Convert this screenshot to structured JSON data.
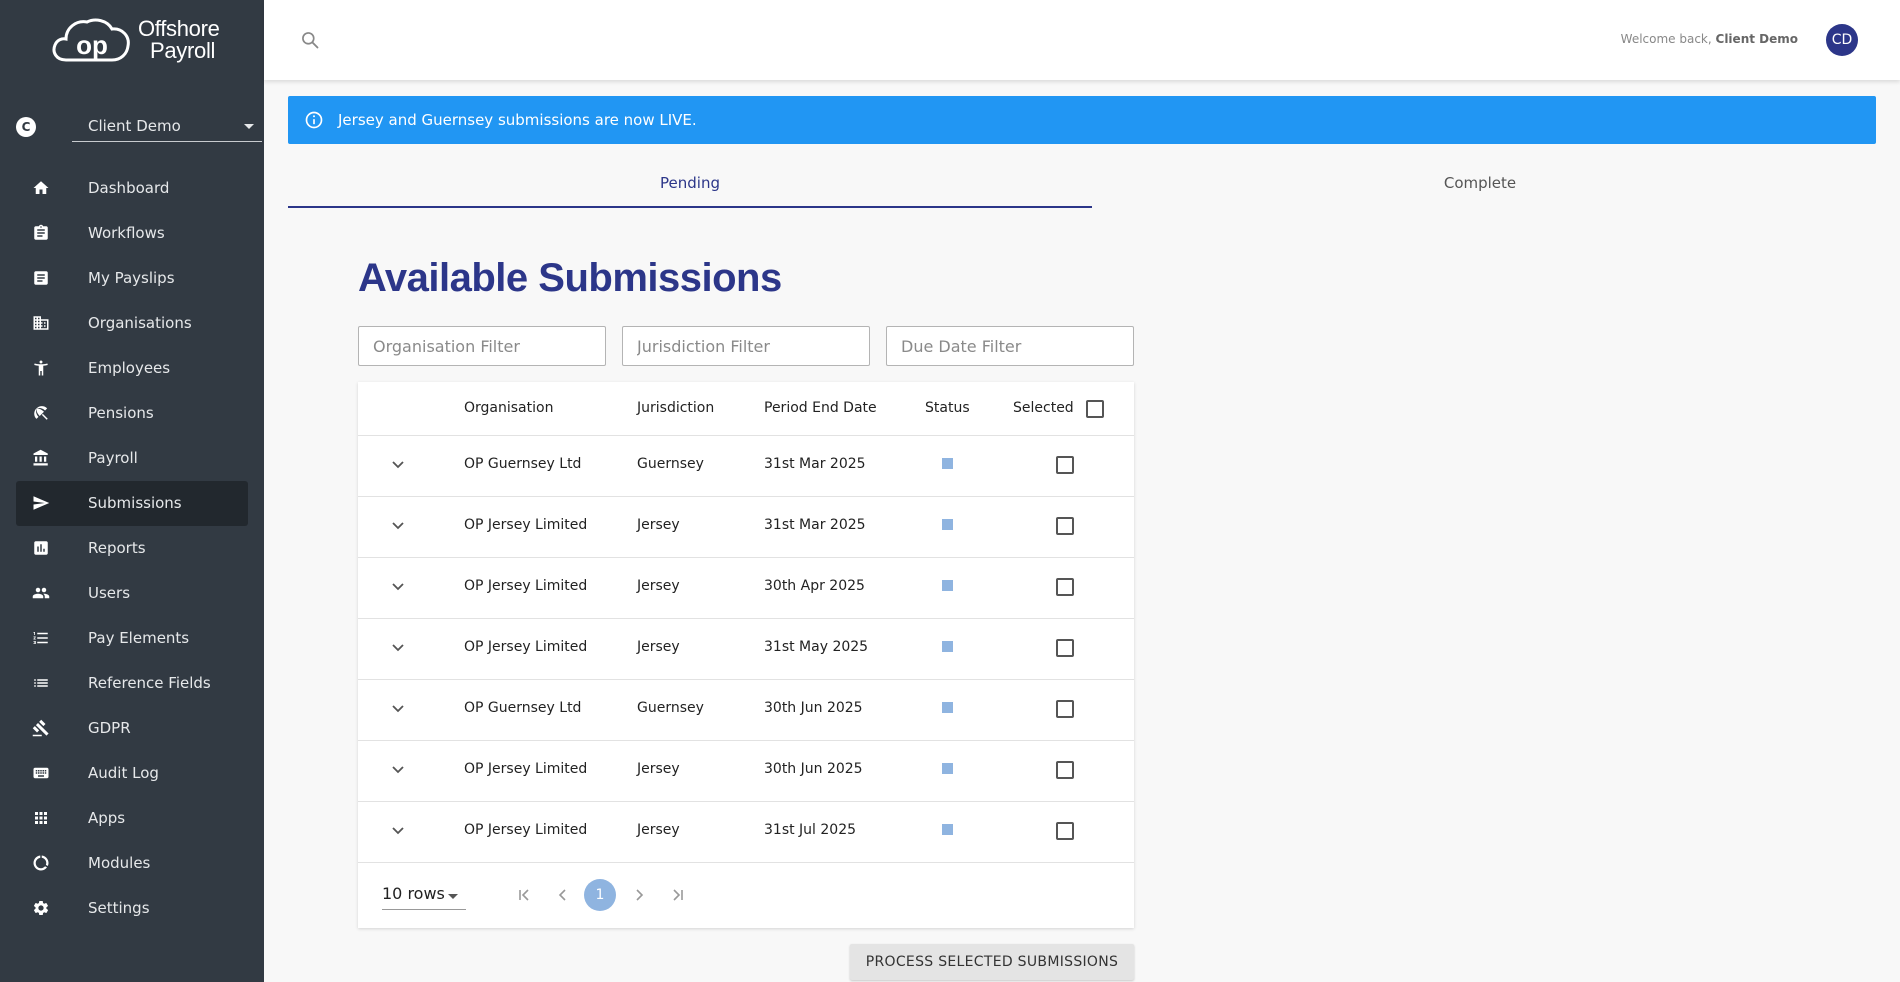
{
  "brand": {
    "line1": "Offshore",
    "line2": "Payroll",
    "mark": "op"
  },
  "client": {
    "badge": "C",
    "selected": "Client Demo"
  },
  "nav": [
    {
      "label": "Dashboard",
      "icon": "home-icon",
      "active": false
    },
    {
      "label": "Workflows",
      "icon": "clipboard-icon",
      "active": false
    },
    {
      "label": "My Payslips",
      "icon": "document-icon",
      "active": false
    },
    {
      "label": "Organisations",
      "icon": "building-icon",
      "active": false
    },
    {
      "label": "Employees",
      "icon": "person-icon",
      "active": false
    },
    {
      "label": "Pensions",
      "icon": "beach-umbrella-icon",
      "active": false
    },
    {
      "label": "Payroll",
      "icon": "bank-icon",
      "active": false
    },
    {
      "label": "Submissions",
      "icon": "send-icon",
      "active": true
    },
    {
      "label": "Reports",
      "icon": "bar-chart-icon",
      "active": false
    },
    {
      "label": "Users",
      "icon": "people-icon",
      "active": false
    },
    {
      "label": "Pay Elements",
      "icon": "numbered-list-icon",
      "active": false
    },
    {
      "label": "Reference Fields",
      "icon": "list-icon",
      "active": false
    },
    {
      "label": "GDPR",
      "icon": "gavel-icon",
      "active": false
    },
    {
      "label": "Audit Log",
      "icon": "keyboard-icon",
      "active": false
    },
    {
      "label": "Apps",
      "icon": "grid-icon",
      "active": false
    },
    {
      "label": "Modules",
      "icon": "donut-icon",
      "active": false
    },
    {
      "label": "Settings",
      "icon": "gear-icon",
      "active": false
    }
  ],
  "header": {
    "welcome_prefix": "Welcome back, ",
    "welcome_name": "Client Demo",
    "avatar": "CD"
  },
  "notice": {
    "text": "Jersey and Guernsey submissions are now LIVE."
  },
  "tabs": {
    "pending": "Pending",
    "complete": "Complete"
  },
  "page": {
    "title": "Available Submissions"
  },
  "filters": {
    "organisation": "Organisation Filter",
    "jurisdiction": "Jurisdiction Filter",
    "due_date": "Due Date Filter"
  },
  "table": {
    "columns": {
      "organisation": "Organisation",
      "jurisdiction": "Jurisdiction",
      "period_end": "Period End Date",
      "status": "Status",
      "selected": "Selected"
    },
    "rows": [
      {
        "organisation": "OP Guernsey Ltd",
        "jurisdiction": "Guernsey",
        "period_end": "31st Mar 2025"
      },
      {
        "organisation": "OP Jersey Limited",
        "jurisdiction": "Jersey",
        "period_end": "31st Mar 2025"
      },
      {
        "organisation": "OP Jersey Limited",
        "jurisdiction": "Jersey",
        "period_end": "30th Apr 2025"
      },
      {
        "organisation": "OP Jersey Limited",
        "jurisdiction": "Jersey",
        "period_end": "31st May 2025"
      },
      {
        "organisation": "OP Guernsey Ltd",
        "jurisdiction": "Guernsey",
        "period_end": "30th Jun 2025"
      },
      {
        "organisation": "OP Jersey Limited",
        "jurisdiction": "Jersey",
        "period_end": "30th Jun 2025"
      },
      {
        "organisation": "OP Jersey Limited",
        "jurisdiction": "Jersey",
        "period_end": "31st Jul 2025"
      }
    ]
  },
  "pager": {
    "rows_label": "10 rows",
    "current_page": "1"
  },
  "actions": {
    "process": "PROCESS SELECTED SUBMISSIONS"
  },
  "colors": {
    "sidebar": "#323a43",
    "accent": "#2c3689",
    "info": "#2196f3",
    "status": "#8fb4e0"
  }
}
